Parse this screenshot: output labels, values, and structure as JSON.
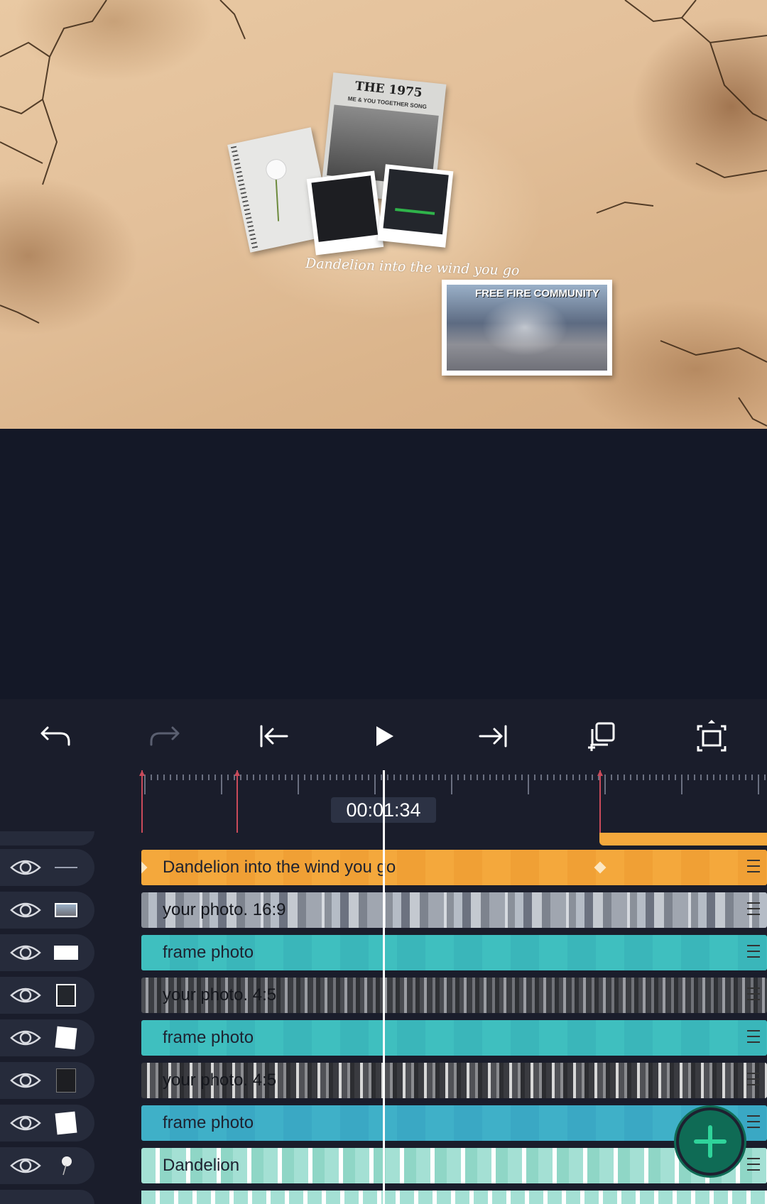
{
  "preview": {
    "newspaper_title": "THE 1975",
    "newspaper_subtitle": "ME & YOU TOGETHER SONG",
    "caption_script": "Dandelion into the wind you go",
    "landscape_text": "FREE FIRE COMMUNITY"
  },
  "toolbar": {
    "undo": "undo-icon",
    "redo": "redo-icon",
    "jump_start": "jump-to-start-icon",
    "play": "play-icon",
    "jump_end": "jump-to-end-icon",
    "duplicate": "duplicate-layer-icon",
    "fullscreen": "fullscreen-icon"
  },
  "timeline": {
    "timecode": "00:01:34",
    "layers": [
      {
        "label": "Dandelion into the wind you go",
        "type": "text",
        "color": "#f4a83c"
      },
      {
        "label": "your photo. 16:9",
        "type": "photo",
        "color": "#8a909a"
      },
      {
        "label": "frame photo",
        "type": "shape",
        "color": "#3fbfbf"
      },
      {
        "label": "your photo. 4:5",
        "type": "photo",
        "color": "#4a4c52"
      },
      {
        "label": "frame photo",
        "type": "shape",
        "color": "#3fbfbf"
      },
      {
        "label": "your photo. 4:5",
        "type": "photo",
        "color": "#3a3b40"
      },
      {
        "label": "frame photo",
        "type": "shape",
        "color": "#3fb0c8"
      },
      {
        "label": "Dandelion",
        "type": "image",
        "color": "#a4e0d4"
      }
    ]
  },
  "fab": {
    "icon": "add-icon",
    "color": "#2fd39a"
  }
}
